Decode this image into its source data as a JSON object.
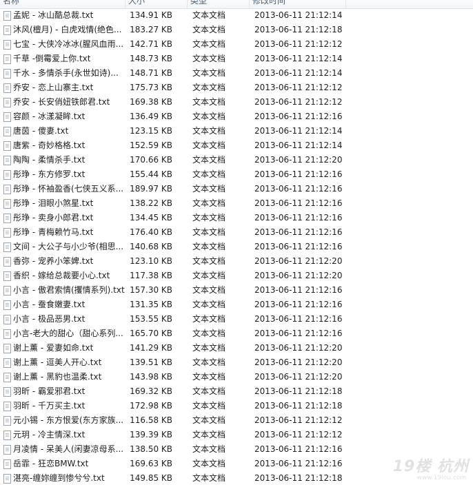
{
  "columns": {
    "name": "名称",
    "size": "大小",
    "type": "类型",
    "date": "修改时间"
  },
  "files": [
    {
      "name": "孟妮 - 冰山酷总裁.txt",
      "size": "134.91 KB",
      "type": "文本文档",
      "date": "2013-06-11 21:12:14"
    },
    {
      "name": "沐风(檀月) - 白虎戏情(绝色...",
      "size": "183.27 KB",
      "type": "文本文档",
      "date": "2013-06-11 21:12:18"
    },
    {
      "name": "七宝 - 大侠冷冰冰(腥风血雨...",
      "size": "142.71 KB",
      "type": "文本文档",
      "date": "2013-06-11 21:12:12"
    },
    {
      "name": "千草 -倒霉爱上你.txt",
      "size": "148.73 KB",
      "type": "文本文档",
      "date": "2013-06-11 21:12:14"
    },
    {
      "name": "千水 - 多情杀手(永世如诗)...",
      "size": "148.71 KB",
      "type": "文本文档",
      "date": "2013-06-11 21:12:14"
    },
    {
      "name": "乔安 - 恋上山寨主.txt",
      "size": "175.73 KB",
      "type": "文本文档",
      "date": "2013-06-11 21:12:12"
    },
    {
      "name": "乔安 - 长安俏妞铁郎君.txt",
      "size": "169.38 KB",
      "type": "文本文档",
      "date": "2013-06-11 21:12:12"
    },
    {
      "name": "容颜 - 冰漾凝眸.txt",
      "size": "136.49 KB",
      "type": "文本文档",
      "date": "2013-06-11 21:12:16"
    },
    {
      "name": "唐茵 - 傻妻.txt",
      "size": "123.15 KB",
      "type": "文本文档",
      "date": "2013-06-11 21:12:14"
    },
    {
      "name": "唐紫 - 奇妙格格.txt",
      "size": "152.59 KB",
      "type": "文本文档",
      "date": "2013-06-11 21:12:14"
    },
    {
      "name": "陶陶 - 柔情杀手.txt",
      "size": "170.66 KB",
      "type": "文本文档",
      "date": "2013-06-11 21:12:20"
    },
    {
      "name": "彤琤 - 东方修罗.txt",
      "size": "155.44 KB",
      "type": "文本文档",
      "date": "2013-06-11 21:12:16"
    },
    {
      "name": "彤琤 - 怀袖盈香(七侠五义系...",
      "size": "189.97 KB",
      "type": "文本文档",
      "date": "2013-06-11 21:12:16"
    },
    {
      "name": "彤琤 - 泪眼小煞星.txt",
      "size": "138.22 KB",
      "type": "文本文档",
      "date": "2013-06-11 21:12:16"
    },
    {
      "name": "彤琤 - 卖身小郎君.txt",
      "size": "134.45 KB",
      "type": "文本文档",
      "date": "2013-06-11 21:12:16"
    },
    {
      "name": "彤琤 - 青梅赖竹马.txt",
      "size": "176.40 KB",
      "type": "文本文档",
      "date": "2013-06-11 21:12:16"
    },
    {
      "name": "文间 - 大公子与小少爷(相思...",
      "size": "140.68 KB",
      "type": "文本文档",
      "date": "2013-06-11 21:12:16"
    },
    {
      "name": "香弥 - 宠养小笨婢.txt",
      "size": "123.10 KB",
      "type": "文本文档",
      "date": "2013-06-11 21:12:20"
    },
    {
      "name": "香织 - 嫁给总裁要小心.txt",
      "size": "117.38 KB",
      "type": "文本文档",
      "date": "2013-06-11 21:12:20"
    },
    {
      "name": "小言 - 傲君索情(攫情系列).txt",
      "size": "157.30 KB",
      "type": "文本文档",
      "date": "2013-06-11 21:12:16"
    },
    {
      "name": "小言 - 蚕食嫩妻.txt",
      "size": "131.35 KB",
      "type": "文本文档",
      "date": "2013-06-11 21:12:16"
    },
    {
      "name": "小言 - 极品恶男.txt",
      "size": "153.55 KB",
      "type": "文本文档",
      "date": "2013-06-11 21:12:16"
    },
    {
      "name": "小言-老大的甜心（甜心系列...",
      "size": "165.70 KB",
      "type": "文本文档",
      "date": "2013-06-11 21:12:16"
    },
    {
      "name": "谢上薰 - 爱妻如命.txt",
      "size": "141.29 KB",
      "type": "文本文档",
      "date": "2013-06-11 21:12:20"
    },
    {
      "name": "谢上薰 - 逗美人开心.txt",
      "size": "139.51 KB",
      "type": "文本文档",
      "date": "2013-06-11 21:12:20"
    },
    {
      "name": "谢上薰 - 黑豹也温柔.txt",
      "size": "143.98 KB",
      "type": "文本文档",
      "date": "2013-06-11 21:12:20"
    },
    {
      "name": "羽昕 - 霸爱邪君.txt",
      "size": "169.32 KB",
      "type": "文本文档",
      "date": "2013-06-11 21:12:18"
    },
    {
      "name": "羽昕 - 千万买主.txt",
      "size": "172.98 KB",
      "type": "文本文档",
      "date": "2013-06-11 21:12:18"
    },
    {
      "name": "元小锡 - 东方恨爱(东方家族...",
      "size": "116.58 KB",
      "type": "文本文档",
      "date": "2013-06-11 21:12:12"
    },
    {
      "name": "元玥 - 冷主情深.txt",
      "size": "139.39 KB",
      "type": "文本文档",
      "date": "2013-06-11 21:12:12"
    },
    {
      "name": "月凌情 - 呆美人(闲妻凉母系...",
      "size": "138.50 KB",
      "type": "文本文档",
      "date": "2013-06-11 21:12:16"
    },
    {
      "name": "岳霏 - 狂恋BMW.txt",
      "size": "169.63 KB",
      "type": "文本文档",
      "date": "2013-06-11 21:12:16"
    },
    {
      "name": "湛亮-缠妳缠到惨兮兮.txt",
      "size": "149.85 KB",
      "type": "文本文档",
      "date": "2013-06-11 21:12:18"
    }
  ],
  "watermark": {
    "main": "19楼 杭州",
    "sub": "www.19lou.com"
  }
}
